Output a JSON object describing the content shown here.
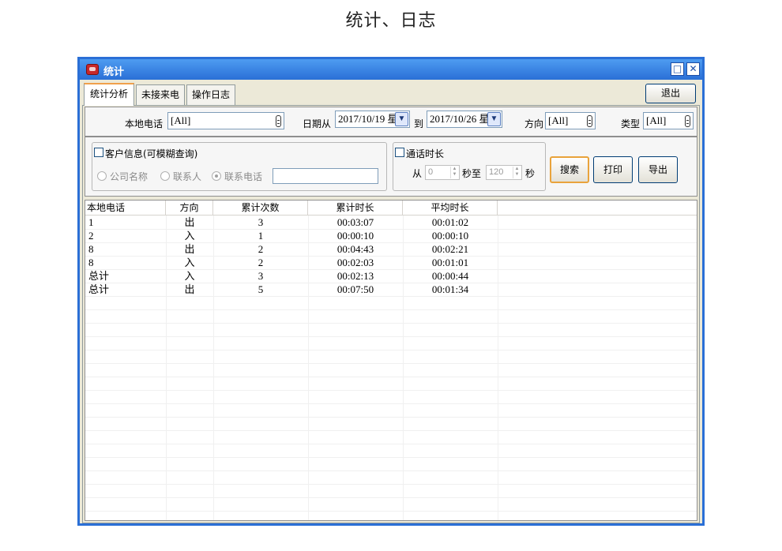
{
  "page": {
    "heading": "统计、日志"
  },
  "window": {
    "title": "统计",
    "maximize_glyph": "□",
    "close_glyph": "✕"
  },
  "tabs": [
    {
      "label": "统计分析",
      "active": true
    },
    {
      "label": "未接来电",
      "active": false
    },
    {
      "label": "操作日志",
      "active": false
    }
  ],
  "exit_label": "退出",
  "filters": {
    "local_phone_label": "本地电话",
    "local_phone_value": "[All]",
    "date_from_label": "日期从",
    "date_from_value": "2017/10/19 星",
    "date_to_label": "到",
    "date_to_value": "2017/10/26 星",
    "direction_label": "方向",
    "direction_value": "[All]",
    "type_label": "类型",
    "type_value": "[All]"
  },
  "customer_group": {
    "checkbox_label": "客户信息(可模糊查询)",
    "checked": false,
    "radios": [
      {
        "label": "公司名称",
        "selected": false
      },
      {
        "label": "联系人",
        "selected": false
      },
      {
        "label": "联系电话",
        "selected": true
      }
    ],
    "search_value": ""
  },
  "duration_group": {
    "checkbox_label": "通话时长",
    "checked": false,
    "from_label": "从",
    "from_value": "0",
    "mid_label": "秒至",
    "to_value": "120",
    "unit_label": "秒"
  },
  "actions": {
    "search": "搜索",
    "print": "打印",
    "export": "导出"
  },
  "table": {
    "headers": [
      "本地电话",
      "方向",
      "累计次数",
      "累计时长",
      "平均时长"
    ],
    "rows": [
      {
        "phone": "1",
        "direction": "出",
        "count": "3",
        "total": "00:03:07",
        "avg": "00:01:02"
      },
      {
        "phone": "2",
        "direction": "入",
        "count": "1",
        "total": "00:00:10",
        "avg": "00:00:10"
      },
      {
        "phone": "8",
        "direction": "出",
        "count": "2",
        "total": "00:04:43",
        "avg": "00:02:21"
      },
      {
        "phone": "8",
        "direction": "入",
        "count": "2",
        "total": "00:02:03",
        "avg": "00:01:01"
      },
      {
        "phone": "总计",
        "direction": "入",
        "count": "3",
        "total": "00:02:13",
        "avg": "00:00:44"
      },
      {
        "phone": "总计",
        "direction": "出",
        "count": "5",
        "total": "00:07:50",
        "avg": "00:01:34"
      }
    ]
  },
  "colors": {
    "titlebar": "#2a6fd6",
    "window_bg": "#ece9d8",
    "focus_border": "#e9a33b"
  }
}
